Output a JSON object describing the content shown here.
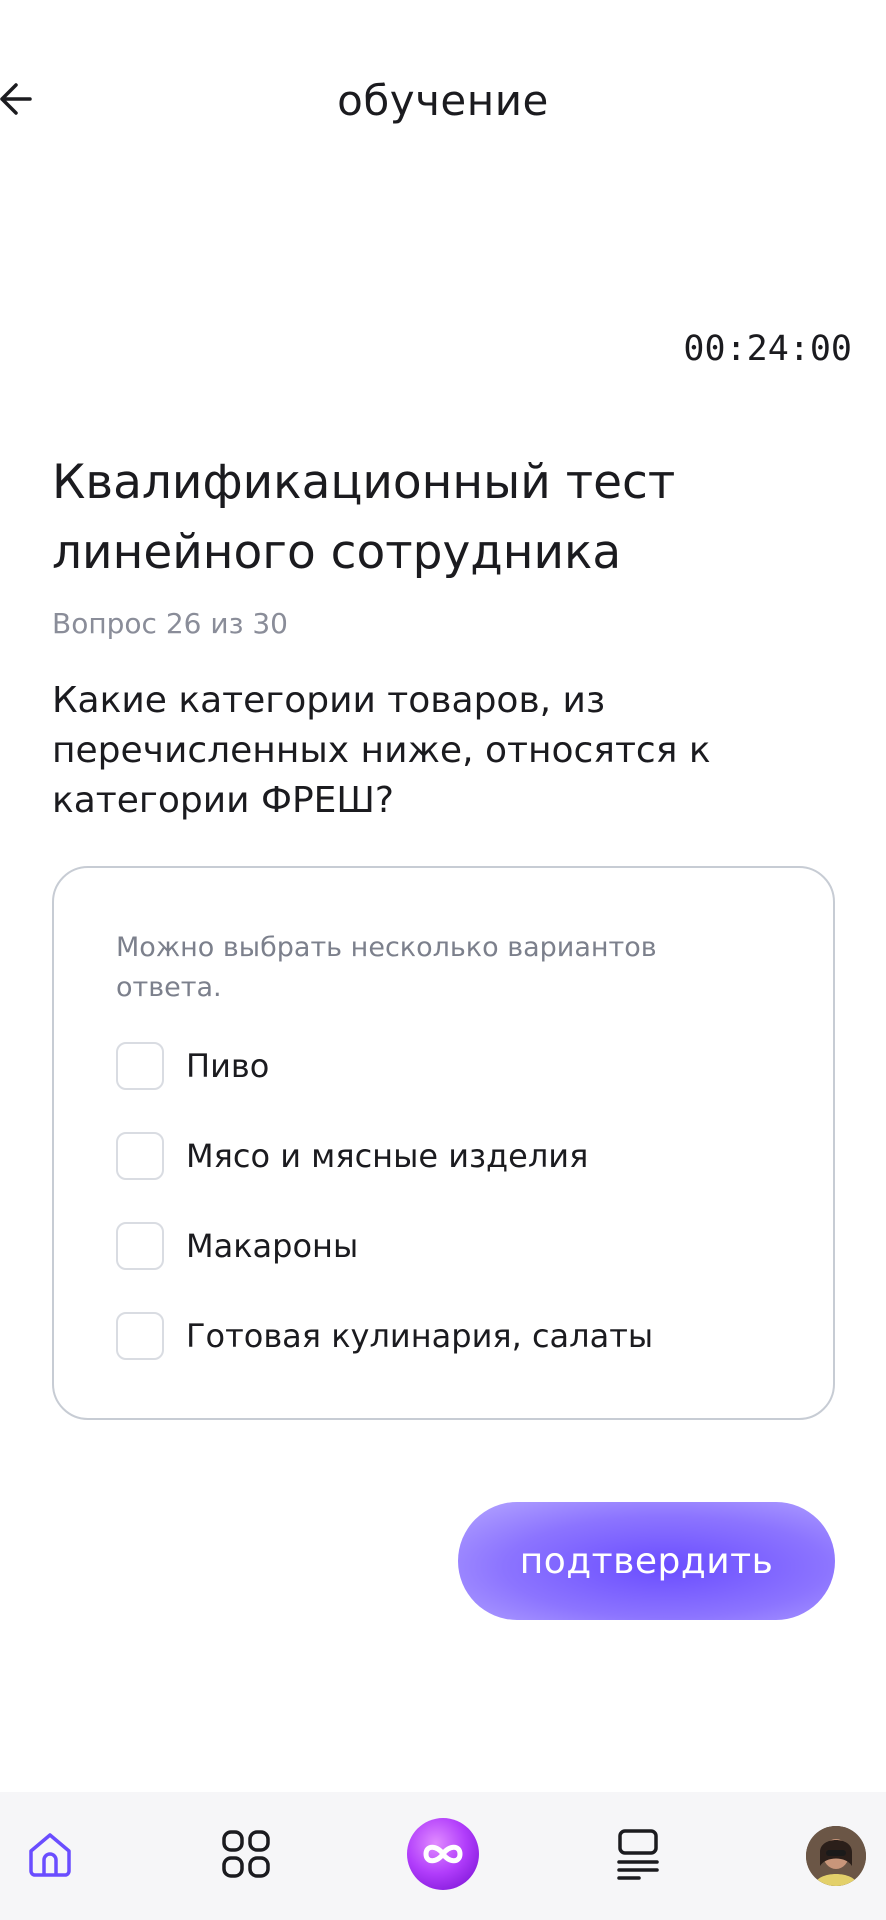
{
  "header": {
    "title": "обучение",
    "back_icon": "arrow-left-icon"
  },
  "timer": "00:24:00",
  "test": {
    "title": "Квалификационный тест линейного сотрудника",
    "counter": "Вопрос 26 из 30",
    "question": "Какие категории товаров, из перечисленных ниже, относятся к категории ФРЕШ?"
  },
  "answers": {
    "hint": "Можно выбрать несколько вариантов ответа.",
    "options": [
      {
        "label": "Пиво",
        "checked": false
      },
      {
        "label": "Мясо и мясные изделия",
        "checked": false
      },
      {
        "label": "Макароны",
        "checked": false
      },
      {
        "label": "Готовая кулинария, салаты",
        "checked": false
      }
    ]
  },
  "confirm_button": "подтвердить",
  "bottom_nav": {
    "items": [
      {
        "icon": "home-icon",
        "active": true
      },
      {
        "icon": "grid-icon",
        "active": false
      },
      {
        "icon": "infinity-icon",
        "active": false
      },
      {
        "icon": "list-icon",
        "active": false
      },
      {
        "icon": "avatar",
        "active": false
      }
    ]
  },
  "colors": {
    "accent": "#6a4dff",
    "text": "#1b1b1f",
    "muted": "#8a8d99",
    "border": "#c7ccd4"
  }
}
